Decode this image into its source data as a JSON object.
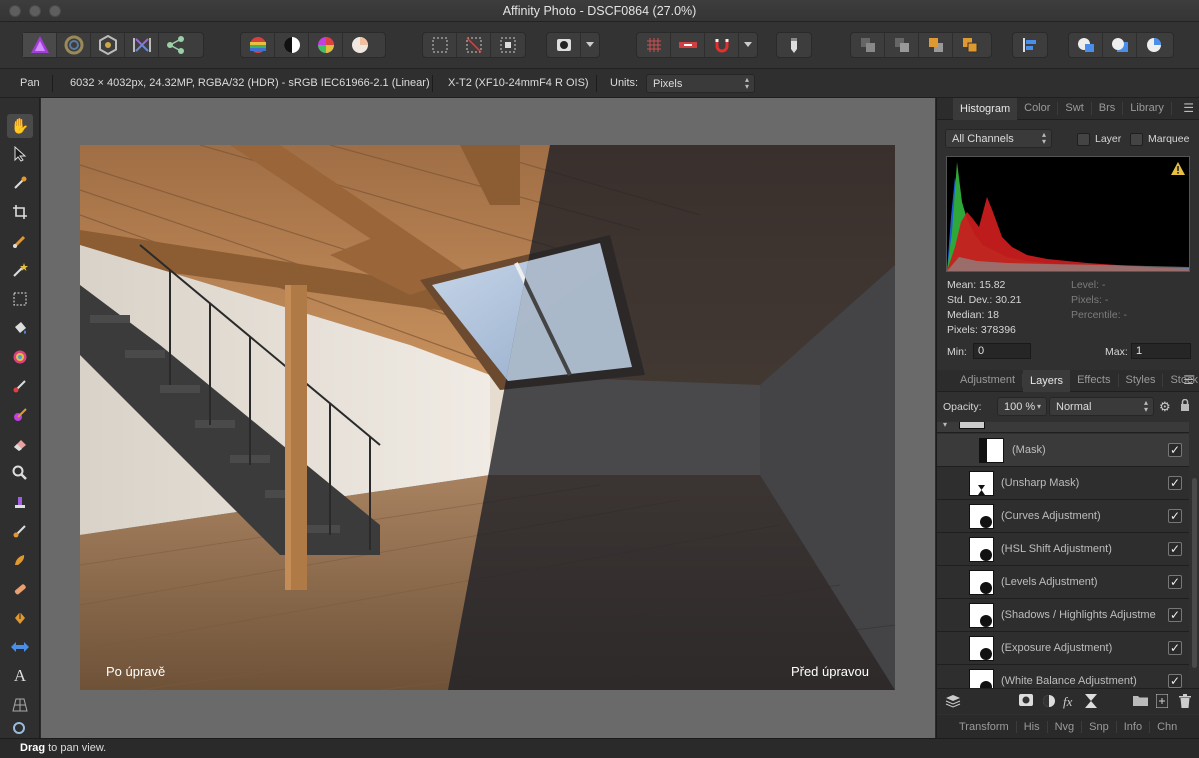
{
  "window": {
    "title": "Affinity Photo - DSCF0864 (27.0%)"
  },
  "context": {
    "tool": "Pan",
    "doc_info": "6032 × 4032px, 24.32MP, RGBA/32 (HDR) - sRGB IEC61966-2.1 (Linear)",
    "camera": "X-T2 (XF10-24mmF4 R OIS)",
    "units_label": "Units:",
    "units_value": "Pixels"
  },
  "canvas": {
    "label_left": "Po úpravě",
    "label_right": "Před úpravou"
  },
  "top_panel": {
    "tabs": [
      "Histogram",
      "Color",
      "Swt",
      "Brs",
      "Library"
    ],
    "active_tab": "Histogram",
    "channel_select": "All Channels",
    "layer_label": "Layer",
    "marquee_label": "Marquee",
    "stats": {
      "mean": "Mean: 15.82",
      "std_dev": "Std. Dev.: 30.21",
      "median": "Median: 18",
      "pixels": "Pixels: 378396",
      "level": "Level: -",
      "pixels_sel": "Pixels: -",
      "percentile": "Percentile: -"
    },
    "min_label": "Min:",
    "min_value": "0",
    "max_label": "Max:",
    "max_value": "1"
  },
  "layers_panel": {
    "tabs": [
      "Adjustment",
      "Layers",
      "Effects",
      "Styles",
      "Stock"
    ],
    "active_tab": "Layers",
    "opacity_label": "Opacity:",
    "opacity_value": "100 %",
    "blend_mode": "Normal",
    "layers": [
      {
        "name": "(Mask)",
        "checked": true
      },
      {
        "name": "(Unsharp Mask)",
        "checked": true
      },
      {
        "name": "(Curves Adjustment)",
        "checked": true
      },
      {
        "name": "(HSL Shift Adjustment)",
        "checked": true
      },
      {
        "name": "(Levels Adjustment)",
        "checked": true
      },
      {
        "name": "(Shadows / Highlights Adjustme",
        "checked": true
      },
      {
        "name": "(Exposure Adjustment)",
        "checked": true
      },
      {
        "name": "(White Balance Adjustment)",
        "checked": true
      }
    ]
  },
  "bottom_tabs": [
    "Transform",
    "His",
    "Nvg",
    "Snp",
    "Info",
    "Chn"
  ],
  "status": {
    "bold": "Drag",
    "text": " to pan view."
  },
  "icons": {
    "personas": [
      "photo-persona-icon",
      "liquify-persona-icon",
      "develop-persona-icon",
      "tone-mapping-persona-icon",
      "export-persona-icon"
    ],
    "tools": [
      "hand-icon",
      "move-icon",
      "color-picker-icon",
      "crop-icon",
      "selection-brush-icon",
      "flood-select-icon",
      "marquee-icon",
      "flood-fill-icon",
      "gradient-icon",
      "paint-brush-icon",
      "color-replace-icon",
      "erase-icon",
      "dodge-icon",
      "clone-icon",
      "blemish-icon",
      "smudge-icon",
      "inpainting-icon",
      "pen-icon",
      "mesh-warp-icon",
      "text-icon",
      "perspective-icon",
      "zoom-icon"
    ]
  }
}
